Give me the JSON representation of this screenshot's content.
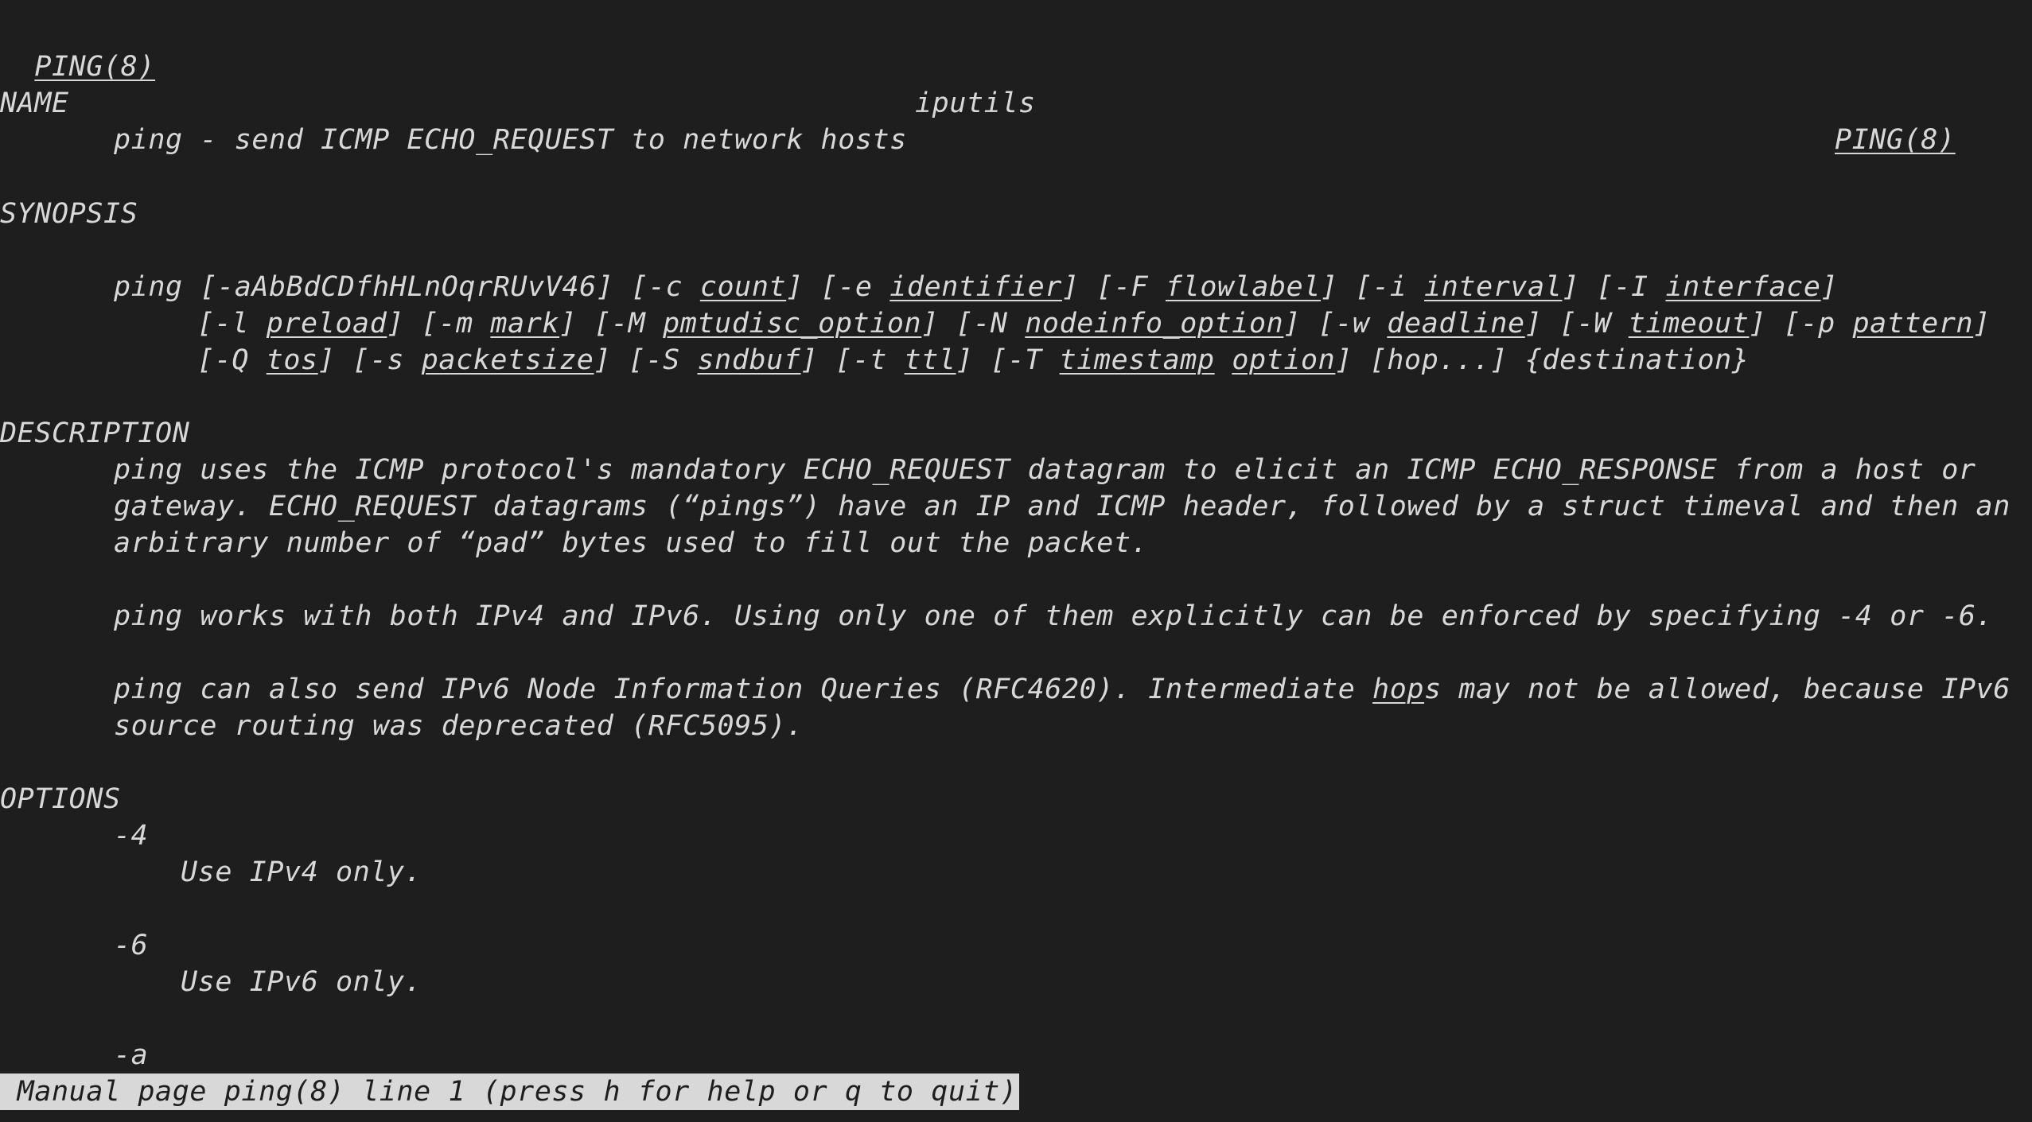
{
  "header": {
    "left": "PING(8)",
    "center": "iputils",
    "right": "PING(8)"
  },
  "sections": {
    "name": {
      "heading": "NAME",
      "text": "ping - send ICMP ECHO_REQUEST to network hosts"
    },
    "synopsis": {
      "heading": "SYNOPSIS",
      "cmd": "ping",
      "line1": [
        " [-aAbBdCDfhHLnOqrRUvV46] [-c ",
        "count",
        "] [-e ",
        "identifier",
        "] [-F ",
        "flowlabel",
        "] [-i ",
        "interval",
        "] [-I ",
        "interface",
        "]"
      ],
      "line2": [
        "[-l ",
        "preload",
        "] [-m ",
        "mark",
        "] [-M ",
        "pmtudisc_option",
        "] [-N ",
        "nodeinfo_option",
        "] [-w ",
        "deadline",
        "] [-W ",
        "timeout",
        "] [-p ",
        "pattern",
        "]"
      ],
      "line3": [
        "[-Q ",
        "tos",
        "] [-s ",
        "packetsize",
        "] [-S ",
        "sndbuf",
        "] [-t ",
        "ttl",
        "] [-T ",
        "timestamp",
        " ",
        "option",
        "] [hop...] {destination}"
      ]
    },
    "description": {
      "heading": "DESCRIPTION",
      "p1": [
        "ping uses the ICMP protocol's mandatory ECHO_REQUEST datagram to elicit an ICMP ECHO_RESPONSE from a host or",
        "gateway. ECHO_REQUEST datagrams (“pings”) have an IP and ICMP header, followed by a struct timeval and then an",
        "arbitrary number of “pad” bytes used to fill out the packet."
      ],
      "p2": "ping works with both IPv4 and IPv6. Using only one of them explicitly can be enforced by specifying -4 or -6.",
      "p3a_pre": "ping can also send IPv6 Node Information Queries (RFC4620). Intermediate ",
      "p3a_link": "hop",
      "p3a_post": "s may not be allowed, because IPv6",
      "p3b": "source routing was deprecated (RFC5095)."
    },
    "options": {
      "heading": "OPTIONS",
      "items": [
        {
          "flag": "-4",
          "desc": "Use IPv4 only."
        },
        {
          "flag": "-6",
          "desc": "Use IPv6 only."
        },
        {
          "flag": "-a",
          "desc": ""
        }
      ]
    }
  },
  "status": "Manual page ping(8) line 1 (press h for help or q to quit)"
}
